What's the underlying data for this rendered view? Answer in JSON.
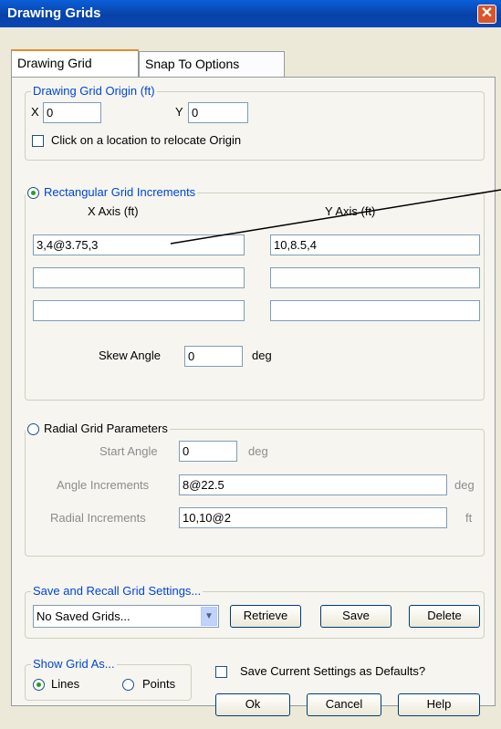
{
  "window": {
    "title": "Drawing Grids",
    "close_glyph": "✕"
  },
  "tabs": [
    {
      "label": "Drawing Grid"
    },
    {
      "label": "Snap To Options"
    }
  ],
  "origin": {
    "group_label": "Drawing Grid Origin (ft)",
    "x_label": "X",
    "x_value": "0",
    "y_label": "Y",
    "y_value": "0",
    "relocate_label": "Click on a location to relocate Origin"
  },
  "rectangular": {
    "group_label": "Rectangular Grid Increments",
    "x_header": "X Axis (ft)",
    "y_header": "Y Axis (ft)",
    "x_values": [
      "3,4@3.75,3",
      "",
      ""
    ],
    "y_values": [
      "10,8.5,4",
      "",
      ""
    ],
    "skew_label": "Skew Angle",
    "skew_value": "0",
    "skew_unit": "deg"
  },
  "radial": {
    "group_label": "Radial Grid Parameters",
    "start_label": "Start Angle",
    "start_value": "0",
    "start_unit": "deg",
    "angle_label": "Angle Increments",
    "angle_value": "8@22.5",
    "angle_unit": "deg",
    "radial_label": "Radial Increments",
    "radial_value": "10,10@2",
    "radial_unit": "ft"
  },
  "saved": {
    "group_label": "Save and Recall Grid Settings...",
    "combo_value": "No Saved Grids...",
    "retrieve": "Retrieve",
    "save": "Save",
    "delete": "Delete"
  },
  "show": {
    "group_label": "Show Grid As...",
    "lines": "Lines",
    "points": "Points"
  },
  "defaults_label": "Save Current Settings as Defaults?",
  "buttons": {
    "ok": "Ok",
    "cancel": "Cancel",
    "help": "Help"
  },
  "colors": {
    "title_bar": "#0a5fd8",
    "group_label": "#0046d5",
    "close": "#d8562c"
  }
}
